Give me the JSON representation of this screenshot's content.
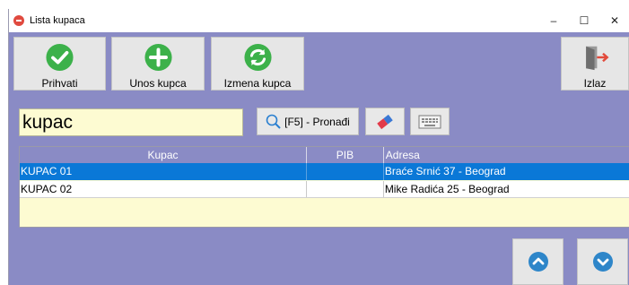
{
  "window": {
    "title": "Lista kupaca",
    "minimize": "–",
    "maximize": "☐",
    "close": "✕"
  },
  "toolbar": {
    "accept_label": "Prihvati",
    "add_label": "Unos kupca",
    "edit_label": "Izmena kupca",
    "exit_label": "Izlaz"
  },
  "search": {
    "value": "kupac",
    "find_label": "[F5] - Pronađi"
  },
  "table": {
    "columns": [
      "Kupac",
      "PIB",
      "Adresa"
    ],
    "rows": [
      {
        "kupac": "KUPAC 01",
        "pib": "",
        "adresa": "Braće Srnić 37 - Beograd"
      },
      {
        "kupac": "KUPAC 02",
        "pib": "",
        "adresa": "Mike Radića 25 - Beograd"
      }
    ],
    "selected_index": 0
  },
  "colors": {
    "accent": "#8a8bc5",
    "selection": "#0a78d7",
    "input_bg": "#fdfbd2",
    "icon_green": "#3cb14a",
    "nav_blue": "#2e86c9"
  }
}
